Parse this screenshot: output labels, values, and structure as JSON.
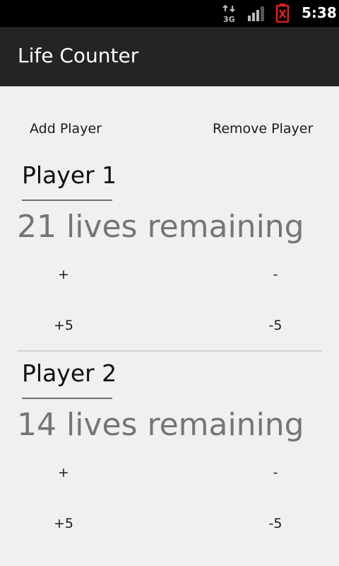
{
  "status_bar": {
    "network_label": "3G",
    "time": "5:38",
    "battery_color": "#e02020"
  },
  "app": {
    "title": "Life Counter"
  },
  "actions": {
    "add_player": "Add Player",
    "remove_player": "Remove Player"
  },
  "players": [
    {
      "name": "Player 1",
      "lives_text": "21 lives remaining",
      "plus": "+",
      "minus": "-",
      "plus5": "+5",
      "minus5": "-5"
    },
    {
      "name": "Player 2",
      "lives_text": "14 lives remaining",
      "plus": "+",
      "minus": "-",
      "plus5": "+5",
      "minus5": "-5"
    }
  ],
  "colors": {
    "background": "#f2eff2",
    "app_bar": "#242424",
    "lives_text": "#757575"
  }
}
